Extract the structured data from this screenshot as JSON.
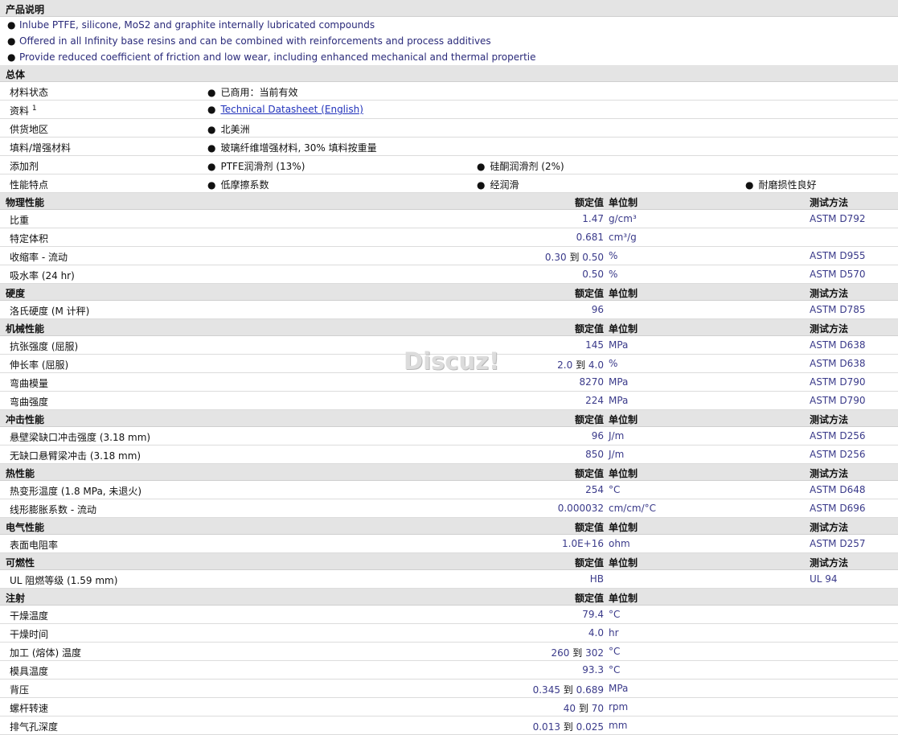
{
  "product_desc": {
    "title": "产品说明",
    "bullets": [
      "Inlube PTFE, silicone, MoS2 and graphite internally lubricated compounds",
      "Offered in all Infinity base resins and can be combined with reinforcements and process additives",
      "Provide reduced coefficient of friction and low wear, including enhanced mechanical and thermal propertie"
    ]
  },
  "general": {
    "title": "总体",
    "rows": [
      {
        "label": "材料状态",
        "c1": "已商用：当前有效"
      },
      {
        "label": "资料",
        "sup": "1",
        "c1": "Technical Datasheet (English)"
      },
      {
        "label": "供货地区",
        "c1": "北美洲"
      },
      {
        "label": "填料/增强材料",
        "c1": "玻璃纤维增强材料, 30% 填料按重量"
      },
      {
        "label": "添加剂",
        "c1": "PTFE润滑剂 (13%)",
        "c2": "硅酮润滑剂 (2%)"
      },
      {
        "label": "性能特点",
        "c1": "低摩擦系数",
        "c2": "经润滑",
        "c3": "耐磨损性良好"
      }
    ]
  },
  "headers": {
    "nominal": "额定值",
    "unit": "单位制",
    "test": "测试方法"
  },
  "to_word": "到",
  "physical": {
    "title": "物理性能",
    "rows": [
      {
        "label": "比重",
        "val": "1.47",
        "unit": "g/cm³",
        "test": "ASTM D792"
      },
      {
        "label": "特定体积",
        "val": "0.681",
        "unit": "cm³/g",
        "test": ""
      },
      {
        "label": "收缩率 - 流动",
        "v1": "0.30",
        "v2": "0.50",
        "unit": "%",
        "test": "ASTM D955"
      },
      {
        "label": "吸水率 (24 hr)",
        "val": "0.50",
        "unit": "%",
        "test": "ASTM D570"
      }
    ]
  },
  "hardness": {
    "title": "硬度",
    "rows": [
      {
        "label": "洛氏硬度 (M 计秤)",
        "val": "96",
        "unit": "",
        "test": "ASTM D785"
      }
    ]
  },
  "mechanical": {
    "title": "机械性能",
    "rows": [
      {
        "label": "抗张强度 (屈服)",
        "val": "145",
        "unit": "MPa",
        "test": "ASTM D638"
      },
      {
        "label": "伸长率 (屈服)",
        "v1": "2.0",
        "v2": "4.0",
        "unit": "%",
        "test": "ASTM D638"
      },
      {
        "label": "弯曲模量",
        "val": "8270",
        "unit": "MPa",
        "test": "ASTM D790"
      },
      {
        "label": "弯曲强度",
        "val": "224",
        "unit": "MPa",
        "test": "ASTM D790"
      }
    ]
  },
  "impact": {
    "title": "冲击性能",
    "rows": [
      {
        "label": "悬壁梁缺口冲击强度 (3.18 mm)",
        "val": "96",
        "unit": "J/m",
        "test": "ASTM D256"
      },
      {
        "label": "无缺口悬臂梁冲击 (3.18 mm)",
        "val": "850",
        "unit": "J/m",
        "test": "ASTM D256"
      }
    ]
  },
  "thermal": {
    "title": "热性能",
    "rows": [
      {
        "label": "热变形温度 (1.8 MPa, 未退火)",
        "val": "254",
        "unit": "°C",
        "test": "ASTM D648"
      },
      {
        "label": "线形膨胀系数 - 流动",
        "val": "0.000032",
        "unit": "cm/cm/°C",
        "test": "ASTM D696"
      }
    ]
  },
  "electrical": {
    "title": "电气性能",
    "rows": [
      {
        "label": "表面电阻率",
        "val": "1.0E+16",
        "unit": "ohm",
        "test": "ASTM D257"
      }
    ]
  },
  "flammability": {
    "title": "可燃性",
    "rows": [
      {
        "label": "UL 阻燃等级 (1.59 mm)",
        "val": "HB",
        "unit": "",
        "test": "UL 94"
      }
    ]
  },
  "injection": {
    "title": "注射",
    "rows": [
      {
        "label": "干燥温度",
        "val": "79.4",
        "unit": "°C"
      },
      {
        "label": "干燥时间",
        "val": "4.0",
        "unit": "hr"
      },
      {
        "label": "加工 (熔体) 温度",
        "v1": "260",
        "v2": "302",
        "unit": "°C"
      },
      {
        "label": "模具温度",
        "val": "93.3",
        "unit": "°C"
      },
      {
        "label": "背压",
        "v1": "0.345",
        "v2": "0.689",
        "unit": "MPa"
      },
      {
        "label": "螺杆转速",
        "v1": "40",
        "v2": "70",
        "unit": "rpm"
      },
      {
        "label": "排气孔深度",
        "v1": "0.013",
        "v2": "0.025",
        "unit": "mm"
      }
    ]
  },
  "watermark": "Discuz!"
}
